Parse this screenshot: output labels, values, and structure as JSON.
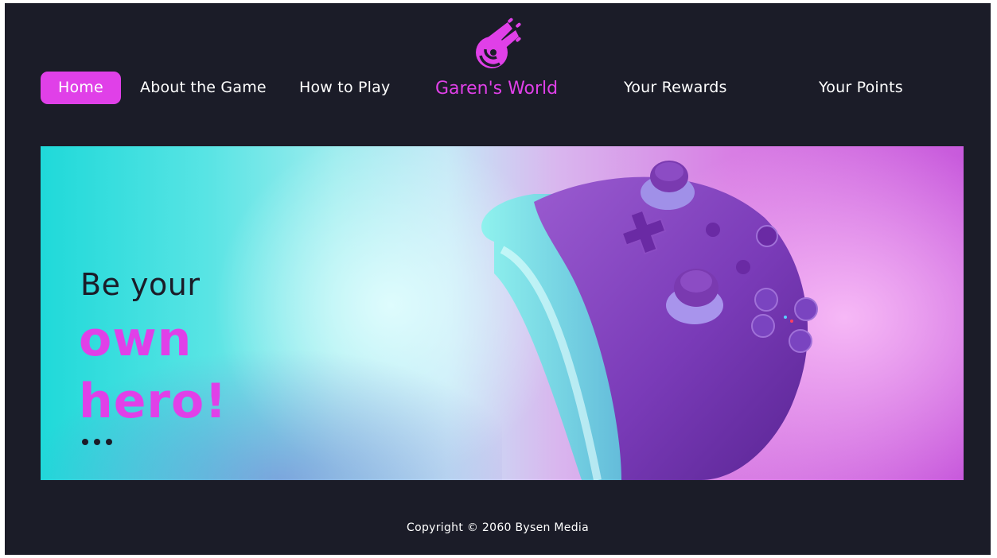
{
  "nav": {
    "home": "Home",
    "about": "About the Game",
    "how_to_play": "How to Play",
    "brand": "Garen's World",
    "rewards": "Your Rewards",
    "points": "Your Points"
  },
  "hero": {
    "line1": "Be your",
    "line2": "own",
    "line3": "hero!"
  },
  "footer": {
    "copyright": "Copyright © 2060 Bysen Media"
  },
  "colors": {
    "background": "#1b1c28",
    "accent": "#e040e8",
    "text": "#ffffff"
  },
  "icons": {
    "logo": "comet-logo-icon",
    "slider_dots": "ellipsis-icon"
  }
}
